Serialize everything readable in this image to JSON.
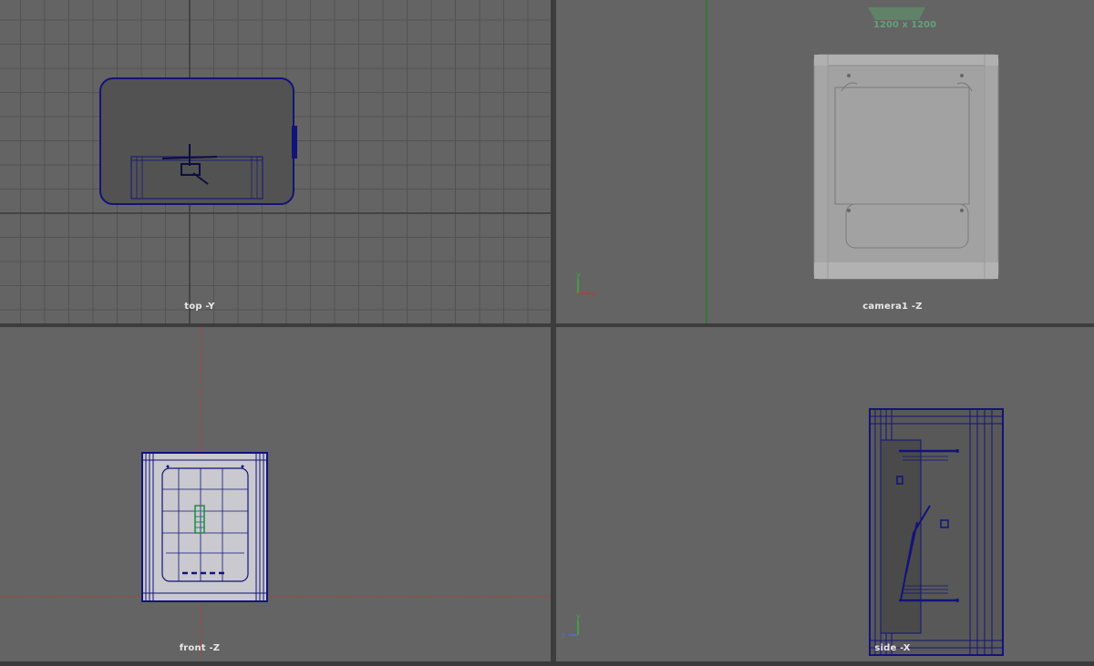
{
  "viewports": {
    "top": {
      "label": "top -Y"
    },
    "perspective": {
      "label": "camera1 -Z",
      "resolution_gate": "1200 x 1200"
    },
    "front": {
      "label": "front -Z"
    },
    "side": {
      "label": "side -X"
    }
  },
  "colors": {
    "viewport_bg": "#646464",
    "grid_line": "#505050",
    "wireframe": "#13137a",
    "selected_component": "#1d8a4a",
    "axis_red": "#c83232",
    "axis_green": "#2f8c2f",
    "solid_shaded": "#a8a8a8"
  },
  "axis_gizmo": {
    "perspective": [
      "y",
      "x"
    ],
    "side": [
      "y",
      "z"
    ]
  }
}
